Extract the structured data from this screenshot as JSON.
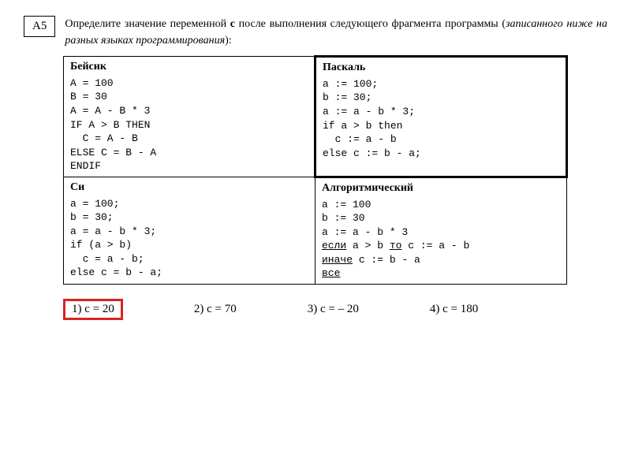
{
  "question": {
    "label": "А5",
    "text_before": "Определите значение переменной ",
    "var": "с",
    "text_after": " после выполнения следующего фрагмента программы (",
    "italic": "записанного ниже на разных языках программирования",
    "text_end": "):"
  },
  "langs": {
    "basic": {
      "name": "Бейсик",
      "code": "A = 100\nB = 30\nA = A - B * 3\nIF A > B THEN\n  C = A - B\nELSE C = B - A\nENDIF"
    },
    "pascal": {
      "name": "Паскаль",
      "code": "a := 100;\nb := 30;\na := a - b * 3;\nif a > b then\n  c := a - b\nelse c := b - a;"
    },
    "c": {
      "name": "Си",
      "code": "a = 100;\nb = 30;\na = a - b * 3;\nif (a > b)\n  c = a - b;\nelse c = b - a;"
    },
    "algo": {
      "name": "Алгоритмический",
      "l1": "a := 100",
      "l2": "b := 30",
      "l3": "a := a - b * 3",
      "l4_kw": "если",
      "l4_cond": " a > b ",
      "l4_kw2": "то",
      "l4_rest": " c := a - b",
      "l5_kw": "иначе",
      "l5_rest": " c := b - a",
      "l6_kw": "все"
    }
  },
  "answers": {
    "a1": "1)  c = 20",
    "a2": "2)  c = 70",
    "a3": "3)  c = – 20",
    "a4": "4)  c = 180"
  }
}
